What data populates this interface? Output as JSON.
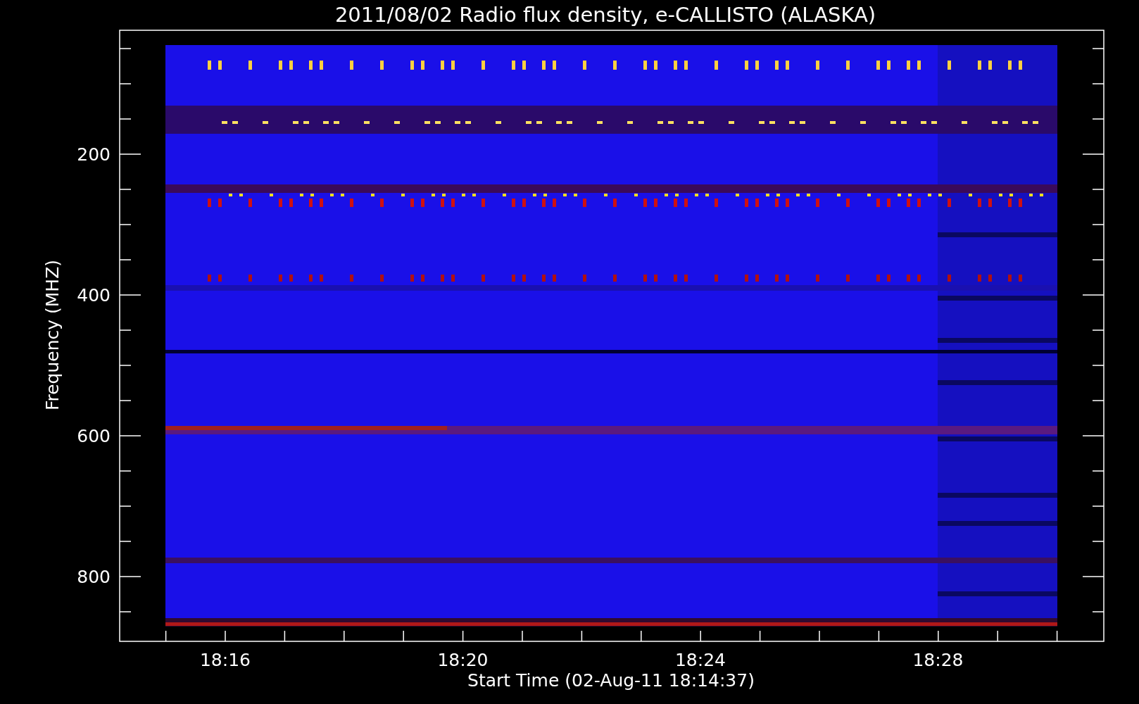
{
  "title": "2011/08/02  Radio flux density, e-CALLISTO (ALASKA)",
  "ylabel": "Frequency (MHZ)",
  "xlabel": "Start Time (02-Aug-11 18:14:37)",
  "yticks": [
    {
      "label": "200"
    },
    {
      "label": "400"
    },
    {
      "label": "600"
    },
    {
      "label": "800"
    }
  ],
  "xticks": [
    {
      "label": "18:16"
    },
    {
      "label": "18:20"
    },
    {
      "label": "18:24"
    },
    {
      "label": "18:28"
    }
  ]
}
